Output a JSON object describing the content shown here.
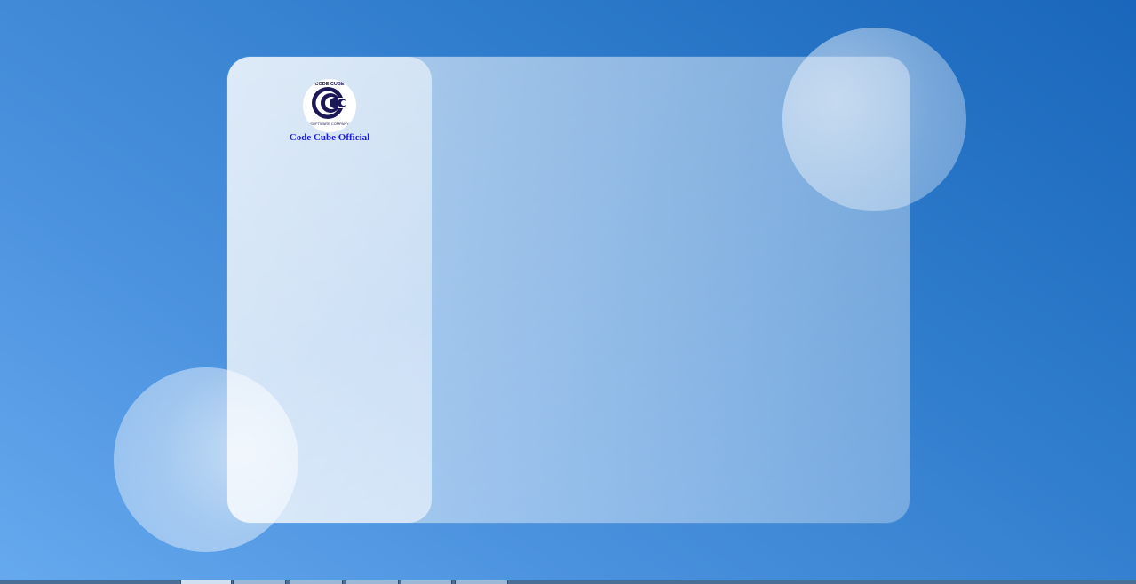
{
  "brand": {
    "name": "Code Cube Official",
    "logo_top_text": "CODE CUBE",
    "logo_bottom_text": "SOFTWARE COMPANY",
    "logo_icon": "code-cube-logo-icon"
  },
  "colors": {
    "background_start": "#66a9ee",
    "background_end": "#1966bb",
    "brand_text": "#1a1adb",
    "logo_dark": "#1c1858"
  }
}
